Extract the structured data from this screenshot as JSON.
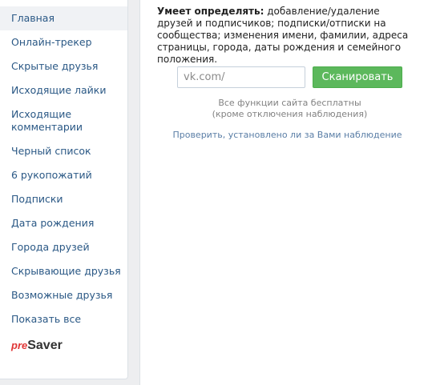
{
  "sidebar": {
    "items": [
      {
        "label": "Главная",
        "active": true
      },
      {
        "label": "Онлайн-трекер"
      },
      {
        "label": "Скрытые друзья"
      },
      {
        "label": "Исходящие лайки"
      },
      {
        "label": "Исходящие комментарии"
      },
      {
        "label": "Черный список"
      },
      {
        "label": "6 рукопожатий"
      },
      {
        "label": "Подписки"
      },
      {
        "label": "Дата рождения"
      },
      {
        "label": "Города друзей"
      },
      {
        "label": "Скрывающие друзья"
      },
      {
        "label": "Возможные друзья"
      },
      {
        "label": "Показать все"
      }
    ],
    "brand": {
      "pre": "pre",
      "saver": "Saver"
    }
  },
  "main": {
    "description_bold": "Умеет определять:",
    "description_text": " добавление/удаление друзей и подписчиков; подписки/отписки на сообщества; изменения имени, фамилии, адреса страницы, города, даты рождения и семейного положения.",
    "search": {
      "placeholder": "vk.com/",
      "value": ""
    },
    "scan_button": "Сканировать",
    "free_note_line1": "Все функции сайта бесплатны",
    "free_note_line2": "(кроме отключения наблюдения)",
    "check_link": "Проверить, установлено ли за Вами наблюдение"
  },
  "colors": {
    "link": "#2a5885",
    "button": "#5cb85c",
    "brand_pre": "#e03535"
  }
}
